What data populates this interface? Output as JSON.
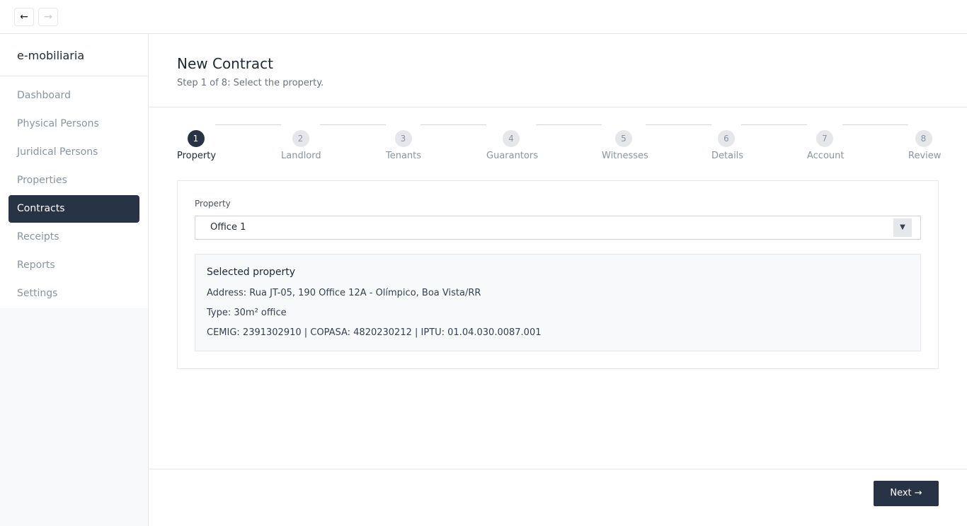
{
  "browser": {
    "back_icon": "←",
    "forward_icon": "→"
  },
  "sidebar": {
    "brand": "e-mobiliaria",
    "items": [
      {
        "label": "Dashboard",
        "active": false
      },
      {
        "label": "Physical Persons",
        "active": false
      },
      {
        "label": "Juridical Persons",
        "active": false
      },
      {
        "label": "Properties",
        "active": false
      },
      {
        "label": "Contracts",
        "active": true
      },
      {
        "label": "Receipts",
        "active": false
      },
      {
        "label": "Reports",
        "active": false
      },
      {
        "label": "Settings",
        "active": false
      }
    ]
  },
  "header": {
    "title": "New Contract",
    "subtitle": "Step 1 of 8: Select the property."
  },
  "stepper": {
    "steps": [
      {
        "number": "1",
        "label": "Property",
        "active": true
      },
      {
        "number": "2",
        "label": "Landlord",
        "active": false
      },
      {
        "number": "3",
        "label": "Tenants",
        "active": false
      },
      {
        "number": "4",
        "label": "Guarantors",
        "active": false
      },
      {
        "number": "5",
        "label": "Witnesses",
        "active": false
      },
      {
        "number": "6",
        "label": "Details",
        "active": false
      },
      {
        "number": "7",
        "label": "Account",
        "active": false
      },
      {
        "number": "8",
        "label": "Review",
        "active": false
      }
    ]
  },
  "form": {
    "property_label": "Property",
    "property_value": "Office 1",
    "dropdown_icon": "▼"
  },
  "selected_property": {
    "title": "Selected property",
    "address": "Address: Rua JT-05, 190 Office 12A - Olímpico, Boa Vista/RR",
    "type": "Type: 30m² office",
    "ids": "CEMIG: 2391302910 | COPASA: 4820230212 | IPTU: 01.04.030.0087.001"
  },
  "footer": {
    "next_label": "Next →"
  },
  "colors": {
    "primary": "#283345",
    "muted": "#8a94a3",
    "border": "#e5e7eb"
  }
}
